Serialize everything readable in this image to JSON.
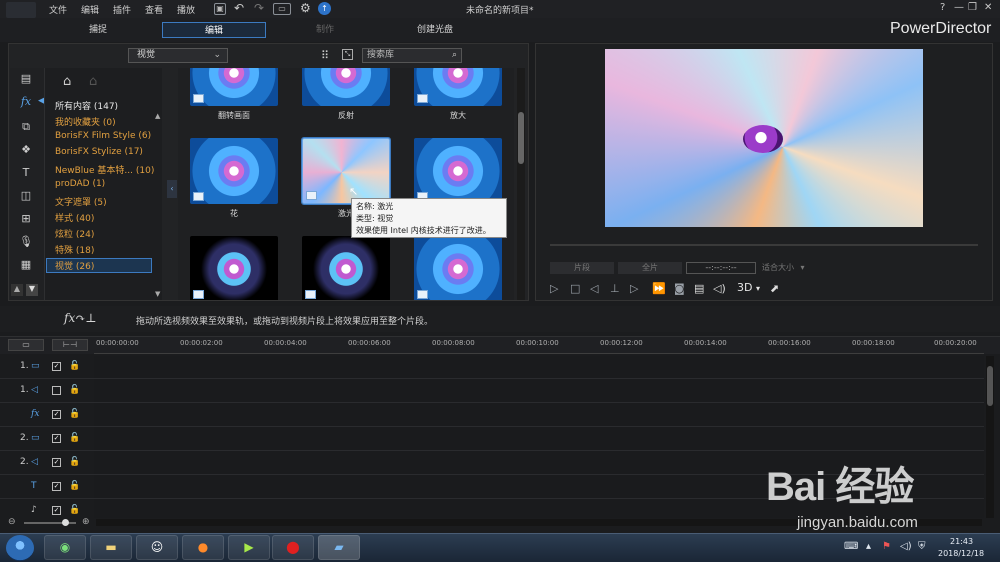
{
  "app": {
    "window_title": "未命名的新项目*",
    "brand": "PowerDirector",
    "menu": [
      "文件",
      "编辑",
      "插件",
      "查看",
      "播放"
    ],
    "window_buttons": [
      "?",
      "—",
      "❐",
      "✕"
    ]
  },
  "modes": {
    "capture": "捕捉",
    "edit": "编辑",
    "produce": "制作",
    "disc": "创建光盘"
  },
  "library": {
    "category_select": "视觉",
    "search_placeholder": "搜索库",
    "categories": [
      "所有内容 (147)",
      "我的收藏夹 (0)",
      "BorisFX Film Style (6)",
      "BorisFX Stylize (17)",
      "NewBlue 基本特... (10)",
      "proDAD (1)",
      "文字遮罩 (5)",
      "样式 (40)",
      "炫粒 (24)",
      "特殊 (18)",
      "视觉 (26)"
    ],
    "thumbs": [
      {
        "label": "翻转画面"
      },
      {
        "label": "反射"
      },
      {
        "label": "放大"
      },
      {
        "label": "花"
      },
      {
        "label": "激光"
      },
      {
        "label": ""
      },
      {
        "label": ""
      },
      {
        "label": ""
      },
      {
        "label": ""
      }
    ],
    "tooltip": {
      "name": "名称: 激光",
      "type": "类型: 视觉",
      "note": "效果使用 Intel 内核技术进行了改进。"
    }
  },
  "preview": {
    "clip_button": "片段",
    "movie_button": "全片",
    "timecode": "--:--:--:--",
    "fit": "适合大小",
    "mode_3d": "3D"
  },
  "instruction": "拖动所选视频效果至效果轨，或拖动到视频片段上将效果应用至整个片段。",
  "timeline": {
    "ruler": [
      "00:00:00:00",
      "00:00:02:00",
      "00:00:04:00",
      "00:00:06:00",
      "00:00:08:00",
      "00:00:10:00",
      "00:00:12:00",
      "00:00:14:00",
      "00:00:16:00",
      "00:00:18:00",
      "00:00:20:00"
    ],
    "tracks": [
      {
        "label": "1.",
        "icon": "video-track-icon",
        "glyph": "▭",
        "checked": "✓"
      },
      {
        "label": "1.",
        "icon": "audio-track-icon",
        "glyph": "◁",
        "checked": ""
      },
      {
        "label": "",
        "icon": "fx-track-icon",
        "glyph": "fx",
        "checked": "✓"
      },
      {
        "label": "2.",
        "icon": "video-track-icon",
        "glyph": "▭",
        "checked": "✓"
      },
      {
        "label": "2.",
        "icon": "audio-track-icon",
        "glyph": "◁",
        "checked": "✓"
      },
      {
        "label": "",
        "icon": "title-track-icon",
        "glyph": "T",
        "checked": "✓"
      },
      {
        "label": "",
        "icon": "voice-track-icon",
        "glyph": "♪",
        "checked": "✓"
      }
    ]
  },
  "taskbar": {
    "time": "21:43",
    "date": "2018/12/18"
  },
  "watermark": {
    "logo": "Bai 经验",
    "url": "jingyan.baidu.com"
  }
}
